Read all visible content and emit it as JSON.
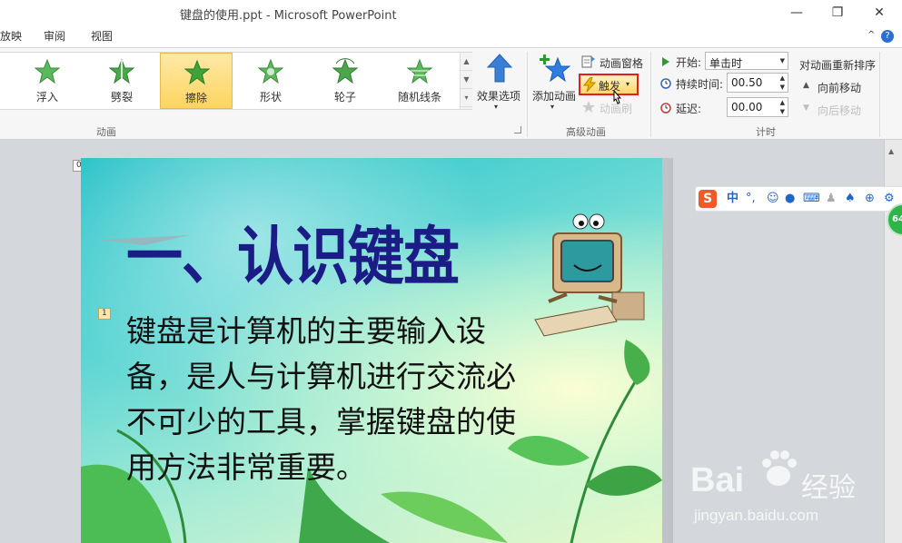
{
  "window": {
    "title": "键盘的使用.ppt - Microsoft PowerPoint",
    "minimize_glyph": "—",
    "restore_glyph": "❐",
    "close_glyph": "✕"
  },
  "tabs": [
    {
      "label": "放映"
    },
    {
      "label": "审阅"
    },
    {
      "label": "视图"
    }
  ],
  "tabs_right": {
    "help": "?",
    "collapse": "^"
  },
  "animation_gallery": {
    "items": [
      {
        "label": "浮入",
        "selected": false
      },
      {
        "label": "劈裂",
        "selected": false
      },
      {
        "label": "擦除",
        "selected": true
      },
      {
        "label": "形状",
        "selected": false
      },
      {
        "label": "轮子",
        "selected": false
      },
      {
        "label": "随机线条",
        "selected": false
      }
    ],
    "effect_options_label": "效果选项",
    "group_label": "动画"
  },
  "advanced": {
    "add_animation_label": "添加动画",
    "pane_label": "动画窗格",
    "trigger_label": "触发",
    "painter_label": "动画刷",
    "group_label": "高级动画"
  },
  "timing": {
    "start_label": "开始:",
    "start_value": "单击时",
    "duration_label": "持续时间:",
    "duration_value": "00.50",
    "delay_label": "延迟:",
    "delay_value": "00.00",
    "group_label": "计时",
    "reorder_label": "对动画重新排序",
    "move_earlier_label": "向前移动",
    "move_later_label": "向后移动"
  },
  "slide": {
    "title": "一、认识键盘",
    "body": "键盘是计算机的主要输入设备，是人与计算机进行交流必不可少的工具，掌握键盘的使用方法非常重要。",
    "tag_0": "0",
    "tag_1": "1"
  },
  "ime_toolbar": {
    "logo": "S",
    "mode": "中",
    "punct": "°,",
    "badge": "64"
  },
  "watermark": {
    "brand": "Bai",
    "brand2": "经验",
    "url": "jingyan.baidu.com"
  },
  "colors": {
    "accent_title": "#1b1c86",
    "selected_gallery": "#fcd45f",
    "highlight_border": "#e02020",
    "star_green": "#3fa33a"
  }
}
